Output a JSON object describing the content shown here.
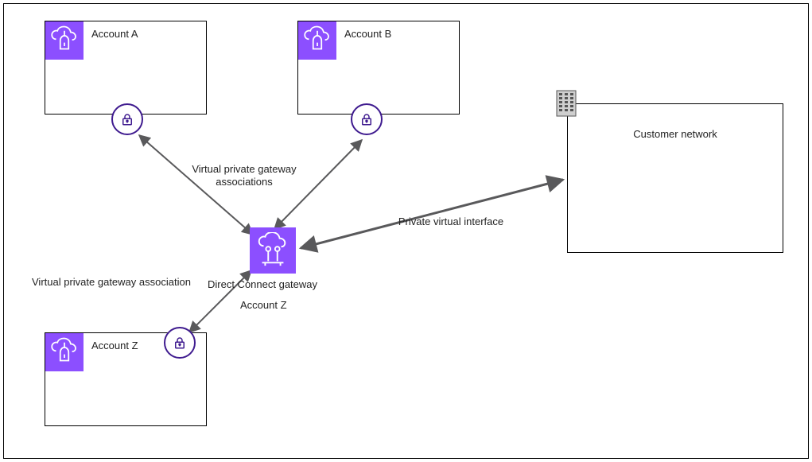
{
  "accounts": {
    "a": "Account A",
    "b": "Account B",
    "z": "Account Z"
  },
  "customer_network": "Customer network",
  "labels": {
    "vpg_assoc_plural": "Virtual private gateway\nassociations",
    "vpg_assoc_single": "Virtual private gateway association",
    "pvi": "Private virtual interface",
    "dcgw": "Direct Connect gateway",
    "dcgw_owner": "Account Z"
  },
  "colors": {
    "aws_purple": "#8C4FFF",
    "lock_purple": "#3F1B8F",
    "arrow_grey": "#59595B"
  }
}
